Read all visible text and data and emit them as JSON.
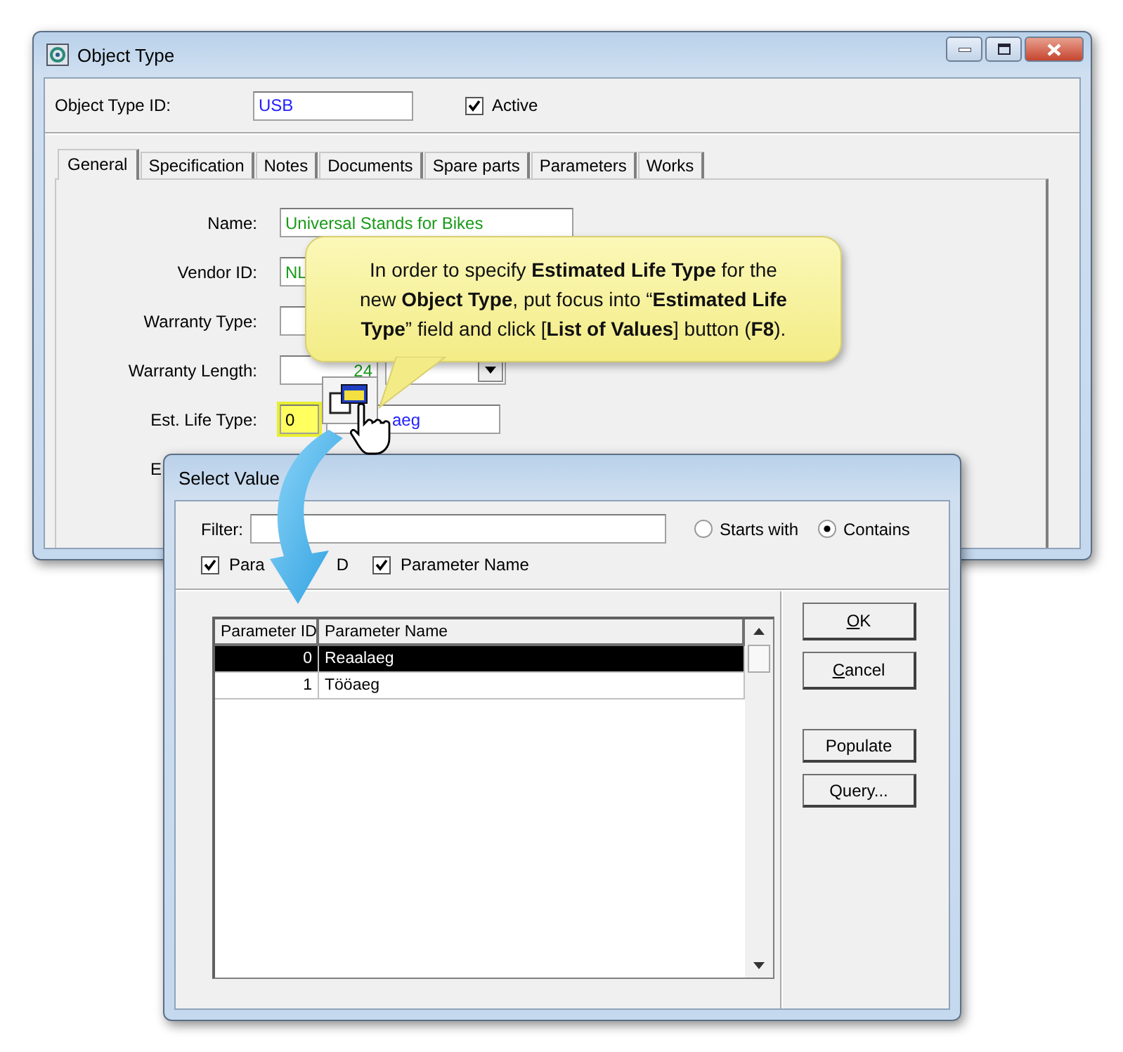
{
  "window": {
    "title": "Object Type"
  },
  "header": {
    "id_label": "Object Type ID:",
    "id_value": "USB",
    "active": {
      "label": "Active",
      "checked": true
    }
  },
  "tabs": [
    {
      "label": "General",
      "selected": true
    },
    {
      "label": "Specification",
      "selected": false
    },
    {
      "label": "Notes",
      "selected": false
    },
    {
      "label": "Documents",
      "selected": false
    },
    {
      "label": "Spare parts",
      "selected": false
    },
    {
      "label": "Parameters",
      "selected": false
    },
    {
      "label": "Works",
      "selected": false
    }
  ],
  "form": [
    {
      "kind": "text",
      "label": "Name:",
      "value": "Universal Stands for Bikes"
    },
    {
      "kind": "text",
      "label": "Vendor ID:",
      "value": "NL"
    },
    {
      "kind": "pair",
      "label": "Warranty Type:",
      "focused": false
    },
    {
      "kind": "number_unit",
      "label": "Warranty Length:",
      "value": "24"
    },
    {
      "kind": "pair",
      "label": "Est. Life Type:",
      "code": "0",
      "value": "aeg",
      "focused": true
    },
    {
      "kind": "covered",
      "label": "E"
    }
  ],
  "callout": {
    "text": "In order to specify **Estimated Life Type** for the\nnew **Object Type**, put focus into “**Estimated Life\nType**” field and click [**List of Values**] button (**F8**)."
  },
  "dialog": {
    "title": "Select Value",
    "filter_label": "Filter:",
    "match": [
      {
        "label": "Starts with",
        "selected": false
      },
      {
        "label": "Contains",
        "selected": true
      }
    ],
    "column_toggles": [
      {
        "label_parts": [
          "Para",
          "D"
        ],
        "checked": true
      },
      {
        "label_parts": [
          "Parameter Name"
        ],
        "checked": true
      }
    ],
    "table": {
      "columns": [
        "Parameter ID",
        "Parameter Name"
      ],
      "rows": [
        {
          "cells": [
            "0",
            "Reaalaeg"
          ],
          "selected": true
        },
        {
          "cells": [
            "1",
            "Tööaeg"
          ],
          "selected": false
        }
      ]
    },
    "buttons": [
      {
        "label": "OK",
        "accelerator": true,
        "kind": "confirm"
      },
      {
        "label": "Cancel",
        "accelerator": true,
        "kind": "confirm"
      },
      {
        "label": "Populate",
        "accelerator": false,
        "kind": "tool"
      },
      {
        "label": "Query...",
        "accelerator": false,
        "kind": "tool"
      }
    ]
  }
}
